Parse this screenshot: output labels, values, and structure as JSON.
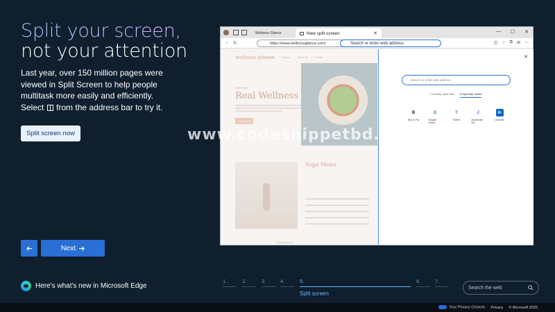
{
  "hero": {
    "title_line1": "Split your screen,",
    "title_line2": "not your attention",
    "description_before": "Last year, over 150 million pages were viewed in Split Screen to help people multitask more easily and efficiently. Select",
    "description_after": "from the address bar to try it.",
    "cta_label": "Split screen now"
  },
  "nav": {
    "prev_icon": "arrow-left-icon",
    "next_label": "Next",
    "next_icon": "arrow-right-icon"
  },
  "brand": {
    "label": "Here's what's new in Microsoft Edge",
    "logo": "edge-logo"
  },
  "steps": {
    "items": [
      "1.",
      "2.",
      "3.",
      "4.",
      "5.",
      "6.",
      "7."
    ],
    "active_index": 4,
    "active_caption": "Split screen"
  },
  "search": {
    "placeholder": "Search the web",
    "icon": "search-icon"
  },
  "footer": {
    "privacy_choices": "Your Privacy Choices",
    "privacy": "Privacy",
    "copyright": "© Microsoft 2025"
  },
  "browser": {
    "tab_inactive_label": "Wellness Glance",
    "tab_active_label": "New split screen",
    "left_url": "https://www.wellnessglance.com/",
    "right_address_placeholder": "Search or enter web address",
    "left_page": {
      "logo": "wellness glance",
      "nav_items": [
        "Home",
        "Recipes",
        "About Us",
        "Contact"
      ],
      "kicker": "Start Here",
      "headline": "Real Wellness",
      "button": "Learn More",
      "section_title": "Yoga Menu",
      "footer_text": "Eating Clean"
    },
    "right_page": {
      "search_placeholder": "Search or enter web address",
      "tabs": [
        "Currently open tabs",
        "Frequently visited"
      ],
      "active_tab_index": 1,
      "tiles": [
        {
          "label": "Buy in Fly",
          "icon": "B",
          "color": "#222222"
        },
        {
          "label": "Google Calen...",
          "icon": "G",
          "color": "#2f8f4e"
        },
        {
          "label": "Twitch",
          "icon": "T",
          "color": "#8c5cd6"
        },
        {
          "label": "Javascript Ltd",
          "icon": "J",
          "color": "#2a6fd6"
        },
        {
          "label": "LinkedIn",
          "icon": "in",
          "color": "#0a66c2"
        }
      ]
    }
  },
  "watermark": "www.codesnippetbd.com",
  "colors": {
    "background": "#0f1f2e",
    "accent": "#2a6fd6",
    "step_active": "#6fb6ff"
  }
}
